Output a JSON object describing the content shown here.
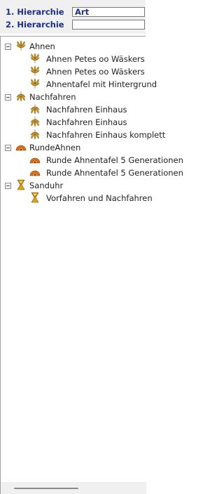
{
  "header": {
    "hier1_label": "1. Hierarchie",
    "hier1_value": "Art",
    "hier2_label": "2. Hierarchie",
    "hier2_value": ""
  },
  "tree": {
    "groups": [
      {
        "label": "Ahnen",
        "icon": "ahnen-fan-icon",
        "children": [
          {
            "label": "Ahnen Petes oo Wäskers"
          },
          {
            "label": "Ahnen Petes oo Wäskers"
          },
          {
            "label": "Ahnentafel mit Hintergrund"
          }
        ]
      },
      {
        "label": "Nachfahren",
        "icon": "nachfahren-fan-icon",
        "children": [
          {
            "label": "Nachfahren Einhaus"
          },
          {
            "label": "Nachfahren Einhaus"
          },
          {
            "label": "Nachfahren Einhaus komplett"
          }
        ]
      },
      {
        "label": "RundeAhnen",
        "icon": "runde-ahnen-icon",
        "children": [
          {
            "label": "Runde Ahnentafel 5 Generationen"
          },
          {
            "label": "Runde Ahnentafel 5 Generationen"
          }
        ]
      },
      {
        "label": "Sanduhr",
        "icon": "sanduhr-icon",
        "children": [
          {
            "label": "Vorfahren und Nachfahren"
          }
        ]
      }
    ]
  },
  "colors": {
    "label_blue": "#1c2f8c",
    "icon_gold": "#d9a21b",
    "icon_orange": "#d9731e"
  }
}
